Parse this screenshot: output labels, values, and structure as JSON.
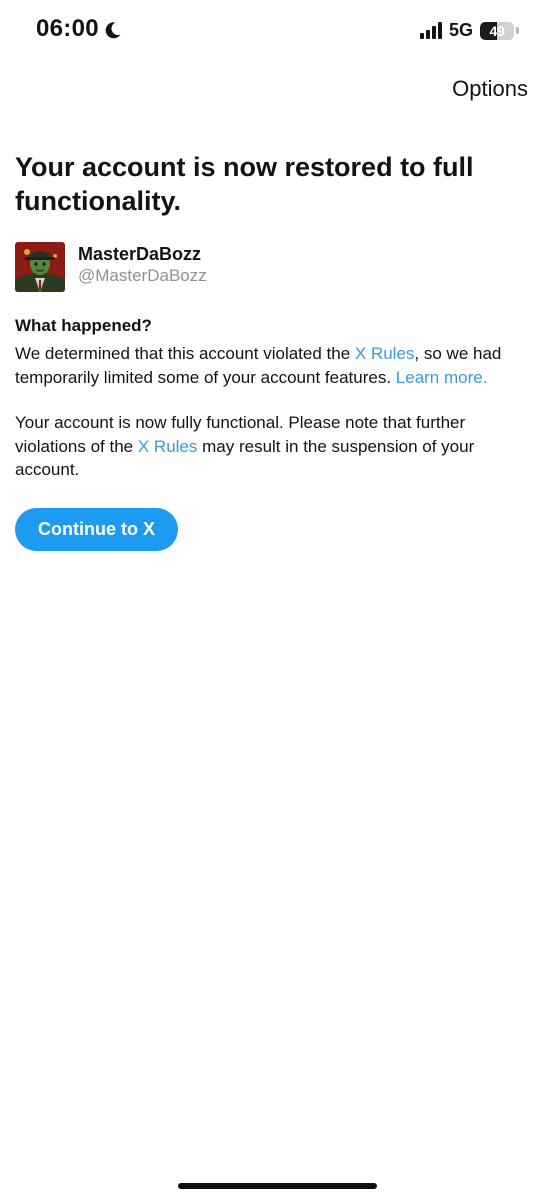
{
  "status_bar": {
    "time": "06:00",
    "network": "5G",
    "battery": "49",
    "battery_level": 0.49,
    "icons": [
      "moon-icon",
      "signal-icon",
      "battery-icon"
    ]
  },
  "header": {
    "options_label": "Options"
  },
  "main": {
    "title": "Your account is now restored to full functionality.",
    "profile": {
      "display_name": "MasterDaBozz",
      "handle": "@MasterDaBozz"
    },
    "what_happened": {
      "heading": "What happened?",
      "p1_before": "We determined that this account violated the ",
      "p1_link": "X Rules",
      "p1_after": ", so we had temporarily limited some of your account features. ",
      "p1_learn_more": "Learn more.",
      "p2_before": "Your account is now fully functional. Please note that further violations of the ",
      "p2_link": "X Rules",
      "p2_after": " may result in the suspension of your account."
    },
    "continue_label": "Continue to X"
  },
  "colors": {
    "accent": "#1d9bf0",
    "link": "#3a9bdc",
    "text": "#0f1419",
    "muted": "#8a939b"
  }
}
